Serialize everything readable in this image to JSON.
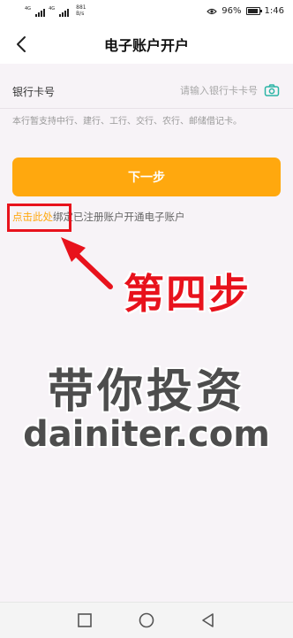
{
  "status_bar": {
    "sim1_tag": "4G",
    "sim2_tag": "4G",
    "net_speed_value": "881",
    "net_speed_unit": "B/s",
    "battery": "96%",
    "time": "1:46",
    "icons": [
      "signal-icon",
      "signal-icon",
      "eye-icon",
      "battery-icon"
    ]
  },
  "header": {
    "title": "电子账户开户",
    "back_icon": "chevron-left-icon"
  },
  "form": {
    "card_label": "银行卡号",
    "card_placeholder": "请输入银行卡卡号",
    "card_value": "",
    "camera_icon": "camera-icon",
    "support_note": "本行暂支持中行、建行、工行、交行、农行、邮储借记卡。"
  },
  "next_button_label": "下一步",
  "bind": {
    "link_text": "点击此处",
    "rest_text": "绑定已注册账户开通电子账户"
  },
  "annotation": {
    "step_label": "第四步",
    "arrow_icon": "arrow-icon"
  },
  "watermark": {
    "line1": "带你投资",
    "line2": "dainiter.com"
  },
  "nav_bar": {
    "icons": [
      "recent-apps-icon",
      "home-icon",
      "back-triangle-icon"
    ]
  },
  "colors": {
    "accent": "#ffa80e",
    "annotation_red": "#e8121c",
    "background": "#f7f3f7",
    "teal_icon": "#2cb5a6"
  }
}
